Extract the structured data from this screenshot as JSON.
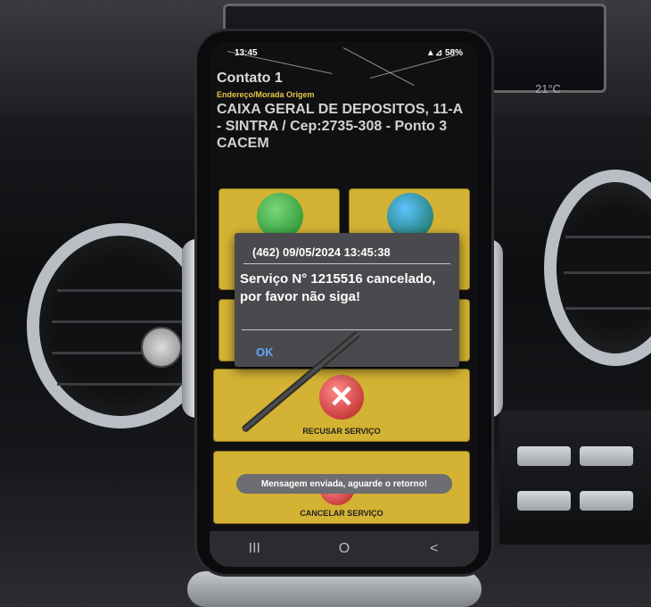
{
  "status_bar": {
    "time": "13:45",
    "signal": "▲⊿",
    "battery": "58%"
  },
  "contact": {
    "title": "Contato 1",
    "origin_label": "Endereço/Morada Origem",
    "address_lines": [
      "CAIXA GERAL DE DEPOSITOS, 11-A",
      "- SINTRA / Cep:2735-308 - Ponto 3",
      "CACEM"
    ]
  },
  "dialog": {
    "title": "(462) 09/05/2024 13:45:38",
    "message_line1": "Serviço N° 1215516 cancelado,",
    "message_line2": "por favor não siga!",
    "ok_label": "OK"
  },
  "tiles": {
    "refuse_label": "RECUSAR SERVIÇO",
    "cancel_label": "CANCELAR SERVIÇO"
  },
  "toast": "Mensagem enviada, aguarde o retorno!",
  "nav": {
    "recent": "III",
    "home": "O",
    "back": "<"
  },
  "car": {
    "temperature": "21°C"
  },
  "colors": {
    "tile": "#d4b233",
    "dialog_bg": "#4a4a4e",
    "ok": "#5fa8ff",
    "origin_label": "#e6c64a"
  },
  "icons": [
    "check-icon",
    "globe-icon",
    "x-icon"
  ]
}
